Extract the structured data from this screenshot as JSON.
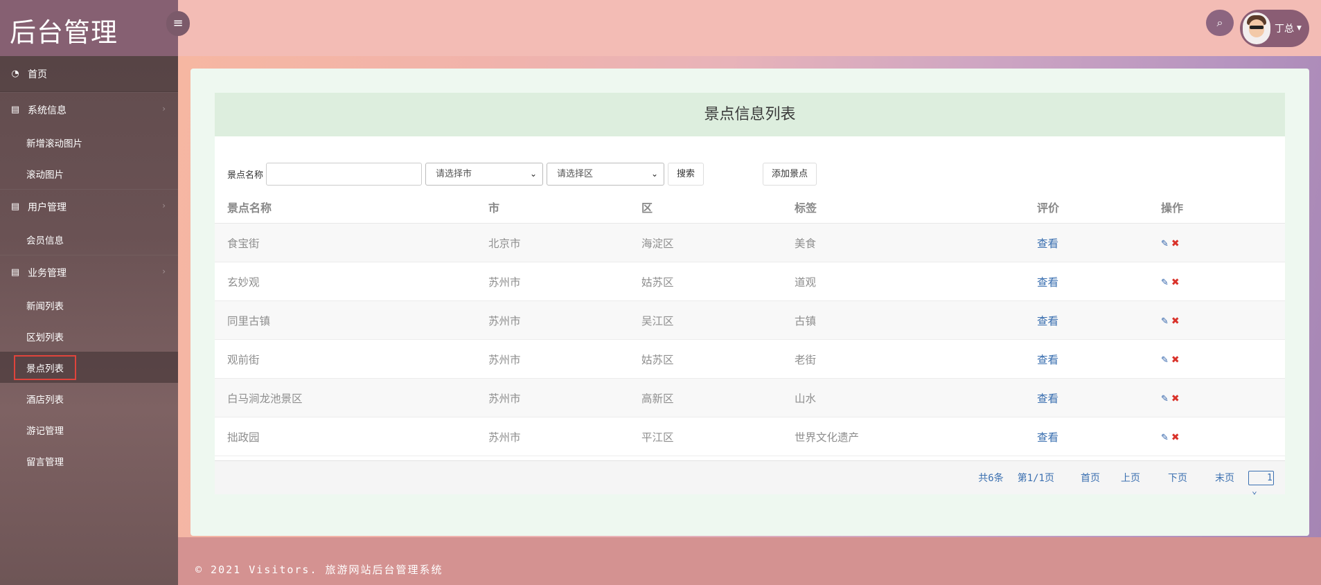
{
  "app": {
    "title": "后台管理"
  },
  "sidebar": {
    "home": "首页",
    "groups": [
      {
        "label": "系统信息",
        "items": [
          "新增滚动图片",
          "滚动图片"
        ]
      },
      {
        "label": "用户管理",
        "items": [
          "会员信息"
        ]
      },
      {
        "label": "业务管理",
        "items": [
          "新闻列表",
          "区划列表",
          "景点列表",
          "酒店列表",
          "游记管理",
          "留言管理"
        ]
      }
    ],
    "active_item": "景点列表"
  },
  "header": {
    "user_name": "丁总"
  },
  "panel": {
    "title": "景点信息列表"
  },
  "filters": {
    "name_label": "景点名称",
    "name_value": "",
    "city_select": "请选择市",
    "district_select": "请选择区",
    "search_label": "搜索",
    "add_label": "添加景点"
  },
  "table": {
    "headers": [
      "景点名称",
      "市",
      "区",
      "标签",
      "评价",
      "操作"
    ],
    "rows": [
      {
        "name": "食宝街",
        "city": "北京市",
        "district": "海淀区",
        "tag": "美食",
        "review": "查看"
      },
      {
        "name": "玄妙观",
        "city": "苏州市",
        "district": "姑苏区",
        "tag": "道观",
        "review": "查看"
      },
      {
        "name": "同里古镇",
        "city": "苏州市",
        "district": "吴江区",
        "tag": "古镇",
        "review": "查看"
      },
      {
        "name": "观前街",
        "city": "苏州市",
        "district": "姑苏区",
        "tag": "老街",
        "review": "查看"
      },
      {
        "name": "白马涧龙池景区",
        "city": "苏州市",
        "district": "高新区",
        "tag": "山水",
        "review": "查看"
      },
      {
        "name": "拙政园",
        "city": "苏州市",
        "district": "平江区",
        "tag": "世界文化遗产",
        "review": "查看"
      }
    ]
  },
  "pager": {
    "total": "共6条",
    "page_info": "第1/1页",
    "first": "首页",
    "prev": "上页",
    "next": "下页",
    "last": "末页",
    "current": "1"
  },
  "footer": {
    "text": "© 2021 Visitors. 旅游网站后台管理系统"
  },
  "colors": {
    "header": "#f3bcb5",
    "sidebar": "#6a5254",
    "logo_bg": "#866072",
    "link": "#3a6fb0",
    "delete": "#d9322a",
    "active_outline": "#e0443c"
  },
  "icons": {
    "home": "dashboard-icon",
    "group": "book-icon",
    "toggle": "menu-icon",
    "search": "search-icon",
    "edit": "pencil-icon",
    "delete": "close-icon"
  }
}
